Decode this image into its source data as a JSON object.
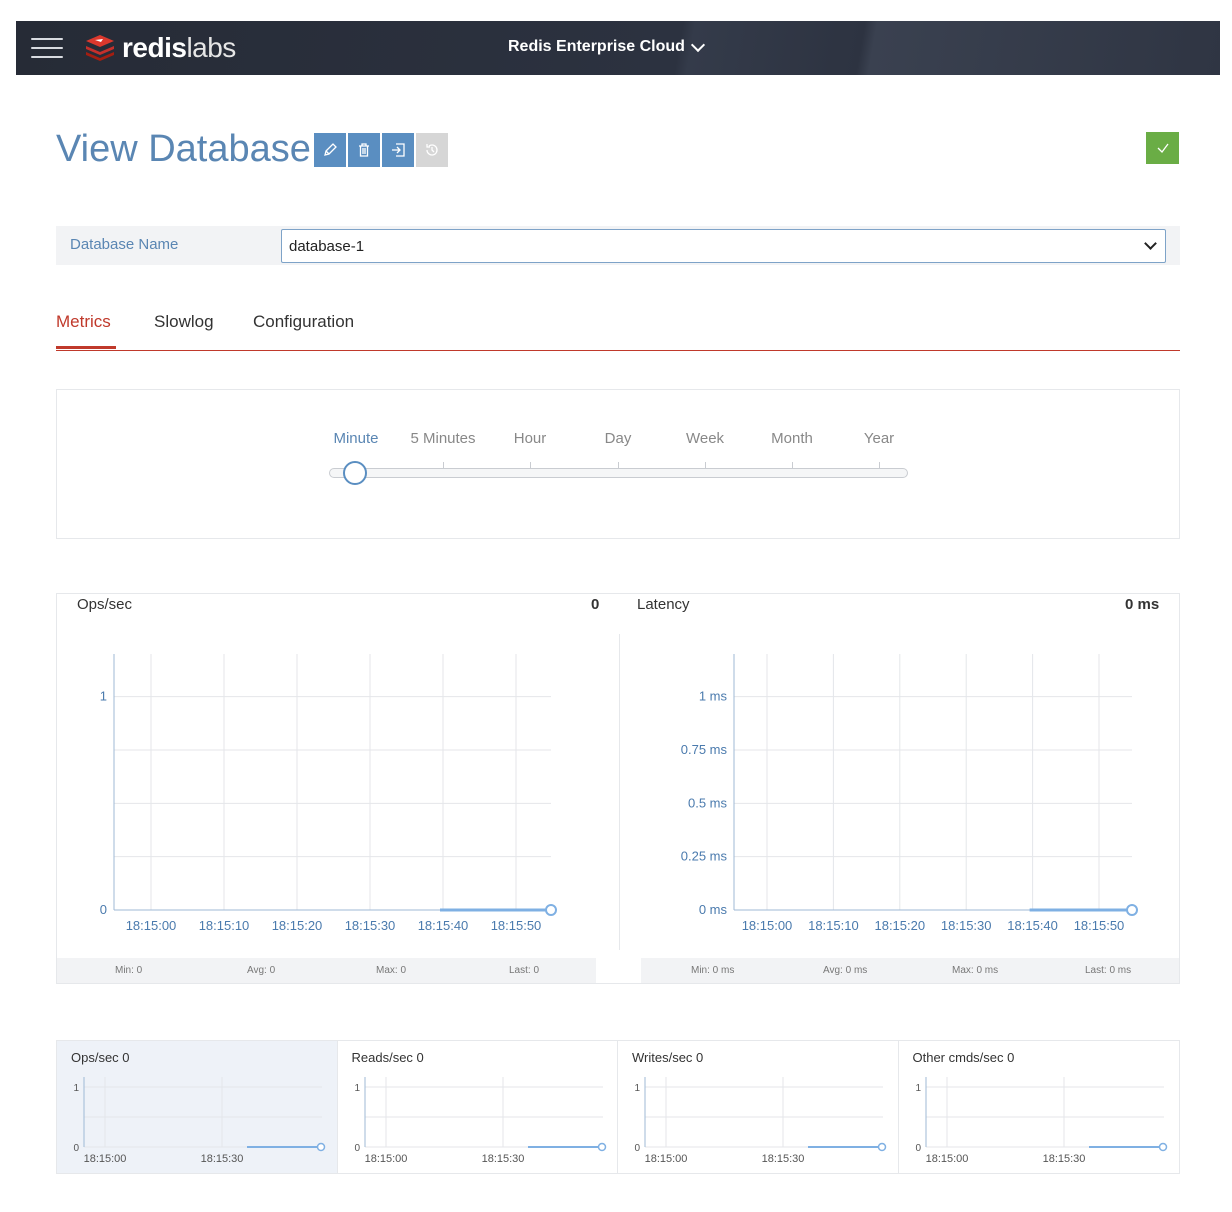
{
  "header": {
    "brand_bold": "redis",
    "brand_light": "labs",
    "environment": "Redis Enterprise Cloud"
  },
  "page": {
    "title": "View Database"
  },
  "database": {
    "label": "Database Name",
    "selected": "database-1"
  },
  "tabs": [
    {
      "label": "Metrics",
      "active": true
    },
    {
      "label": "Slowlog",
      "active": false
    },
    {
      "label": "Configuration",
      "active": false
    }
  ],
  "range": {
    "options": [
      "Minute",
      "5 Minutes",
      "Hour",
      "Day",
      "Week",
      "Month",
      "Year"
    ],
    "selected": "Minute"
  },
  "charts": {
    "ops": {
      "title": "Ops/sec",
      "value": "0",
      "yticks": [
        "1",
        "0"
      ],
      "xticks": [
        "18:15:00",
        "18:15:10",
        "18:15:20",
        "18:15:30",
        "18:15:40",
        "18:15:50"
      ],
      "stats": {
        "min": "Min: 0",
        "avg": "Avg: 0",
        "max": "Max: 0",
        "last": "Last: 0"
      }
    },
    "latency": {
      "title": "Latency",
      "value": "0 ms",
      "yticks": [
        "1 ms",
        "0.75 ms",
        "0.5 ms",
        "0.25 ms",
        "0 ms"
      ],
      "xticks": [
        "18:15:00",
        "18:15:10",
        "18:15:20",
        "18:15:30",
        "18:15:40",
        "18:15:50"
      ],
      "stats": {
        "min": "Min: 0 ms",
        "avg": "Avg: 0 ms",
        "max": "Max: 0 ms",
        "last": "Last: 0 ms"
      }
    }
  },
  "mini_charts": [
    {
      "title": "Ops/sec 0",
      "active": true
    },
    {
      "title": "Reads/sec 0",
      "active": false
    },
    {
      "title": "Writes/sec 0",
      "active": false
    },
    {
      "title": "Other cmds/sec 0",
      "active": false
    }
  ],
  "mini_axis": {
    "yticks": [
      "1",
      "0"
    ],
    "xticks": [
      "18:15:00",
      "18:15:30"
    ]
  },
  "colors": {
    "accent_blue": "#5a8ec1",
    "accent_red": "#c0392b",
    "ok_green": "#6aad45",
    "header_bg": "#2c3240"
  },
  "icons": [
    "menu-icon",
    "redis-logo-icon",
    "chevron-down-icon",
    "pencil-icon",
    "trash-icon",
    "export-icon",
    "history-icon",
    "checkmark-icon"
  ],
  "chart_data": [
    {
      "type": "line",
      "title": "Ops/sec",
      "x": [
        "18:15:40",
        "18:15:50"
      ],
      "series": [
        {
          "values": [
            0,
            0
          ]
        }
      ],
      "ylim": [
        0,
        1.2
      ],
      "grid": true
    },
    {
      "type": "line",
      "title": "Latency",
      "x": [
        "18:15:40",
        "18:15:50"
      ],
      "series": [
        {
          "values": [
            0,
            0
          ]
        }
      ],
      "ylim": [
        0,
        1.2
      ],
      "grid": true
    }
  ]
}
